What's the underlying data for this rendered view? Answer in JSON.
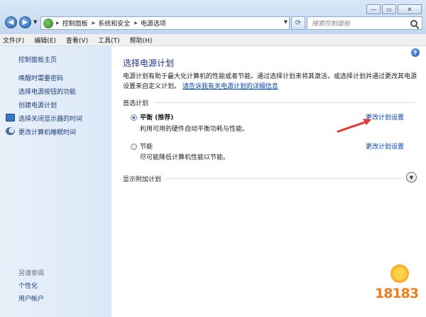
{
  "window": {
    "minimize": "—",
    "maximize": "▭",
    "close": "✕"
  },
  "address_bar": {
    "breadcrumbs": [
      "控制面板",
      "系统和安全",
      "电源选项"
    ],
    "search_placeholder": "搜索控制面板"
  },
  "menu": [
    "文件(F)",
    "编辑(E)",
    "查看(V)",
    "工具(T)",
    "帮助(H)"
  ],
  "sidebar": {
    "home": "控制面板主页",
    "links": [
      "唤醒时需要密码",
      "选择电源按钮的功能",
      "创建电源计划"
    ],
    "icon_links": [
      {
        "label": "选择关闭显示器的时间",
        "icon": "monitor-icon"
      },
      {
        "label": "更改计算机睡眠时间",
        "icon": "moon-icon"
      }
    ],
    "see_also_title": "另请参阅",
    "see_also": [
      "个性化",
      "用户帐户"
    ]
  },
  "main": {
    "title": "选择电源计划",
    "intro": "电源计划有助于最大化计算机的性能或者节能。通过选择计划来将其激活，或选择计划并通过更改其电源设置来自定义计划。",
    "intro_link": "请告诉我有关电源计划的详细信息",
    "section_label": "首选计划",
    "plans": [
      {
        "name": "平衡 (推荐)",
        "desc": "利用可用的硬件自动平衡功耗与性能。",
        "link": "更改计划设置",
        "selected": true
      },
      {
        "name": "节能",
        "desc": "尽可能降低计算机性能以节能。",
        "link": "更改计划设置",
        "selected": false
      }
    ],
    "extra_label": "显示附加计划"
  },
  "watermark": "18183",
  "colors": {
    "link": "#0645ad",
    "title": "#1e3287",
    "arrow": "#e53935"
  }
}
